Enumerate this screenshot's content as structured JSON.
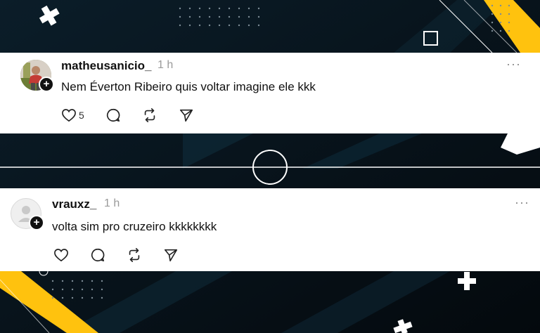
{
  "comments": [
    {
      "username": "matheusanicio_",
      "time": "1 h",
      "text": "Nem Éverton Ribeiro quis voltar imagine ele kkk",
      "likes": "5",
      "more": "···"
    },
    {
      "username": "vrauxz_",
      "time": "1 h",
      "text": "volta sim pro cruzeiro kkkkkkkk",
      "likes": "",
      "more": "···"
    }
  ],
  "icons": {
    "badge": "+"
  },
  "colors": {
    "background": "#07141c",
    "accent": "#ffc20e",
    "card": "#ffffff"
  }
}
